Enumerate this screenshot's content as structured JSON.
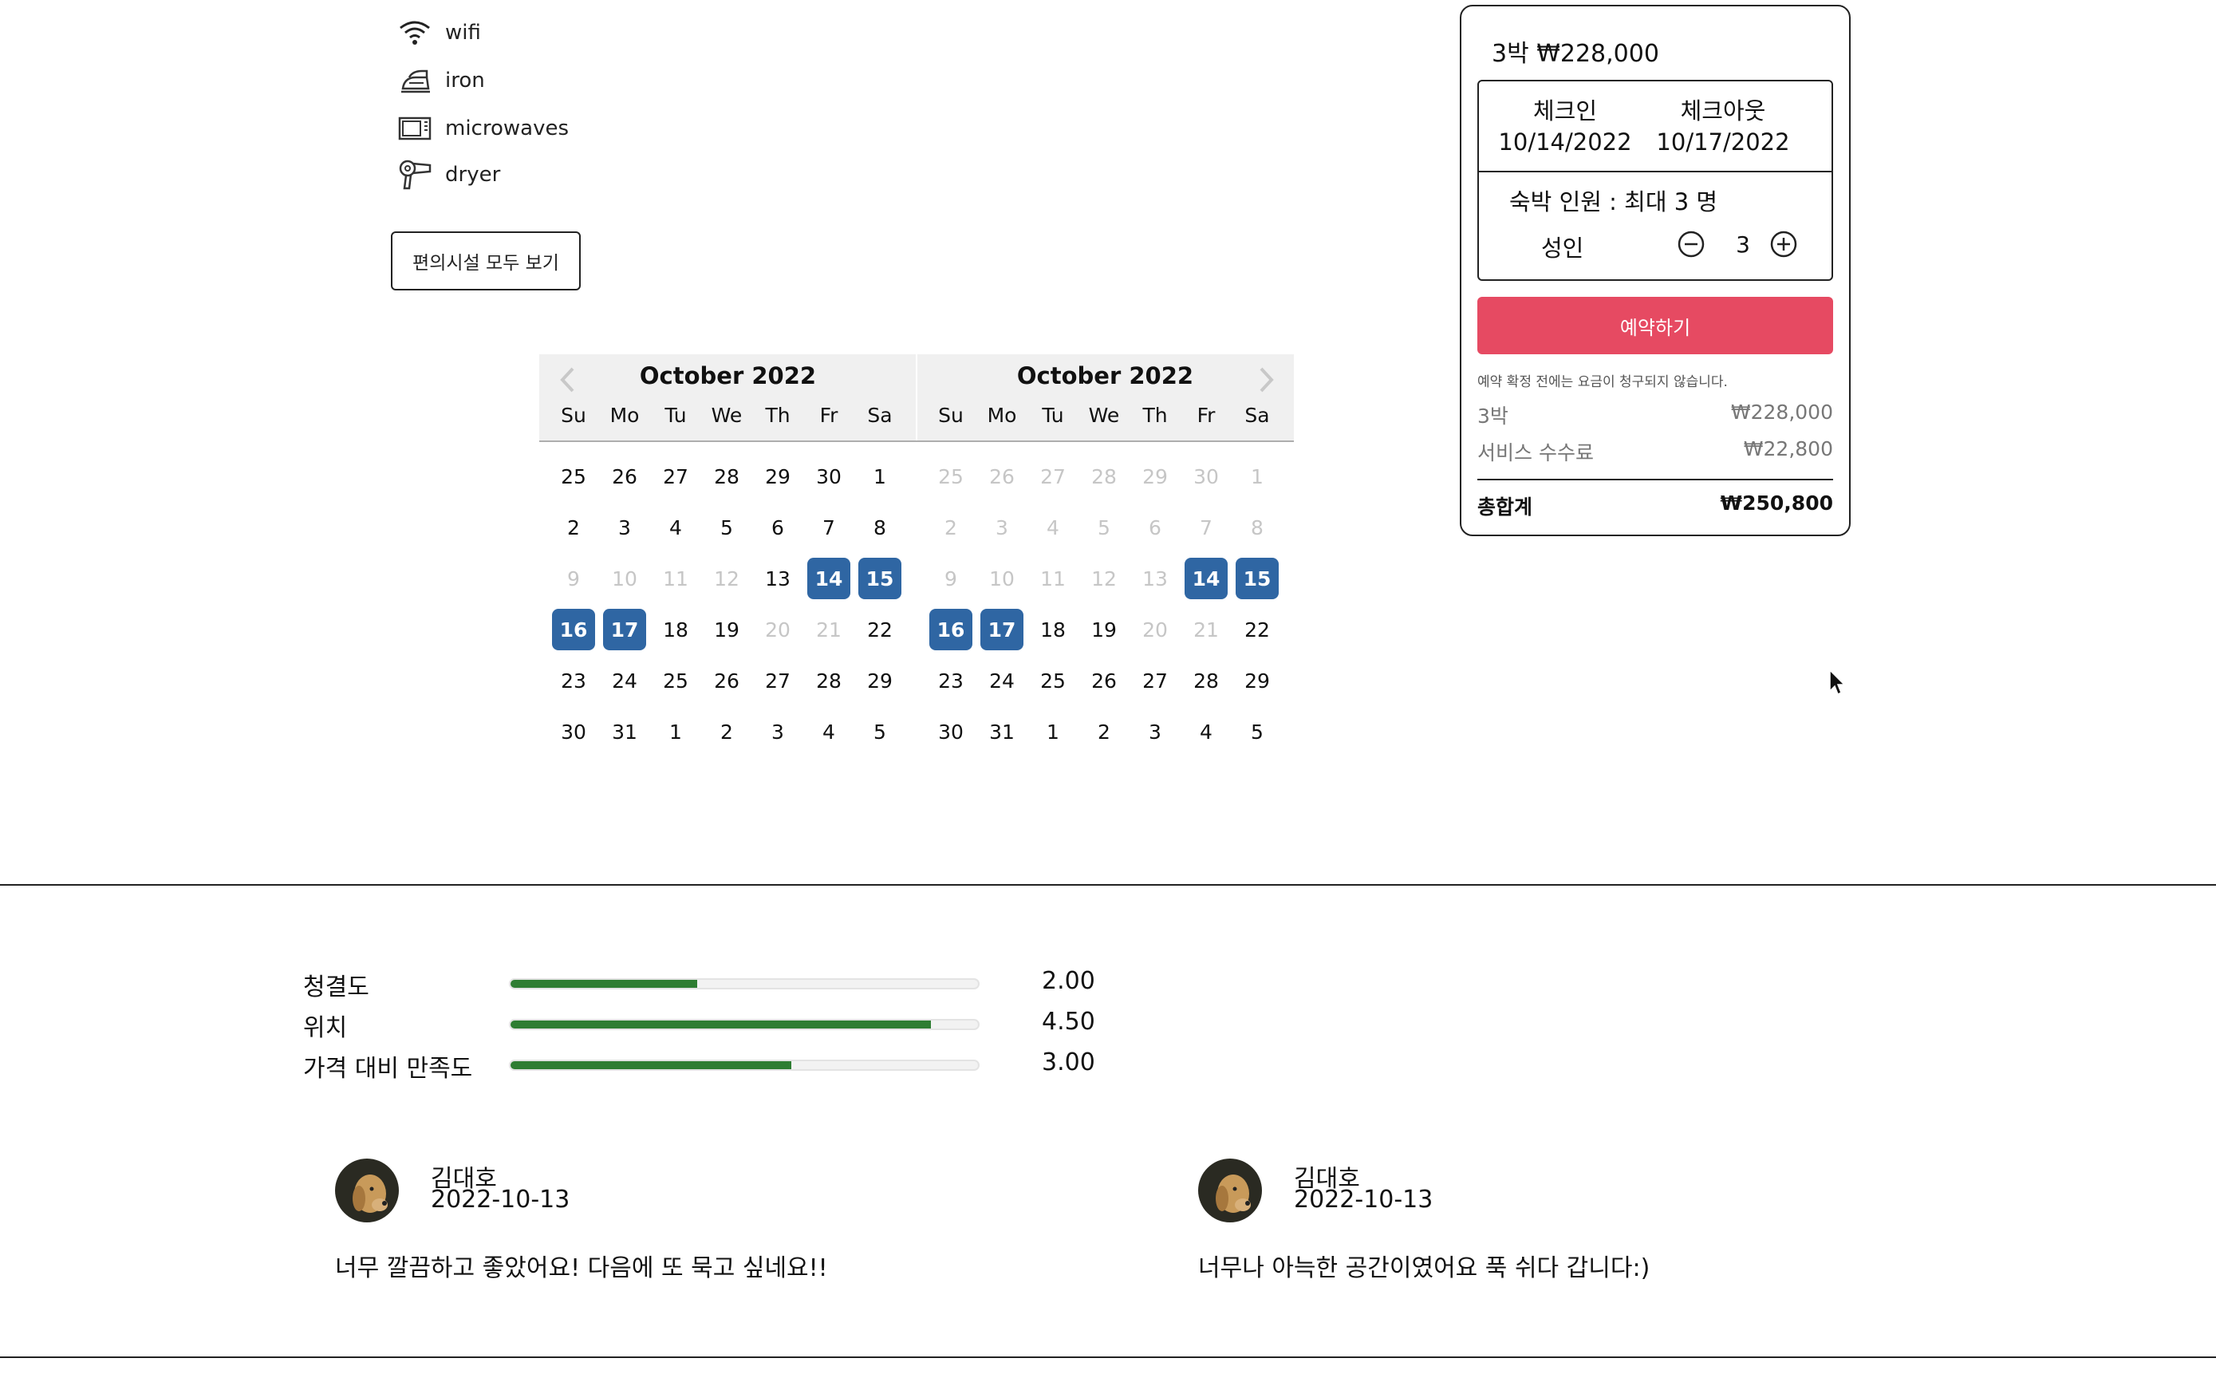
{
  "amenities": {
    "items": [
      {
        "label": "wifi",
        "icon": "wifi-icon"
      },
      {
        "label": "iron",
        "icon": "iron-icon"
      },
      {
        "label": "microwaves",
        "icon": "microwave-icon"
      },
      {
        "label": "dryer",
        "icon": "hair-dryer-icon"
      }
    ],
    "show_all_label": "편의시설 모두 보기"
  },
  "calendar": {
    "months": [
      {
        "title": "October 2022"
      },
      {
        "title": "October 2022"
      }
    ],
    "weekdays": [
      "Su",
      "Mo",
      "Tu",
      "We",
      "Th",
      "Fr",
      "Sa"
    ],
    "selected_color": "#2f66a3",
    "left_month_days": [
      [
        "25",
        "26",
        "27",
        "28",
        "29",
        "30",
        "1"
      ],
      [
        "2",
        "3",
        "4",
        "5",
        "6",
        "7",
        "8"
      ],
      [
        "9",
        "10",
        "11",
        "12",
        "13",
        "14",
        "15"
      ],
      [
        "16",
        "17",
        "18",
        "19",
        "20",
        "21",
        "22"
      ],
      [
        "23",
        "24",
        "25",
        "26",
        "27",
        "28",
        "29"
      ],
      [
        "30",
        "31",
        "1",
        "2",
        "3",
        "4",
        "5"
      ]
    ],
    "right_month_days": [
      [
        "25",
        "26",
        "27",
        "28",
        "29",
        "30",
        "1"
      ],
      [
        "2",
        "3",
        "4",
        "5",
        "6",
        "7",
        "8"
      ],
      [
        "9",
        "10",
        "11",
        "12",
        "13",
        "14",
        "15"
      ],
      [
        "16",
        "17",
        "18",
        "19",
        "20",
        "21",
        "22"
      ],
      [
        "23",
        "24",
        "25",
        "26",
        "27",
        "28",
        "29"
      ],
      [
        "30",
        "31",
        "1",
        "2",
        "3",
        "4",
        "5"
      ]
    ]
  },
  "booking": {
    "price_heading": "3박 ₩228,000",
    "checkin_label": "체크인",
    "checkin_date": "10/14/2022",
    "checkout_label": "체크아웃",
    "checkout_date": "10/17/2022",
    "guests_title": "숙박 인원 : 최대 3 명",
    "adult_label": "성인",
    "adult_count": "3",
    "reserve_label": "예약하기",
    "reserve_color": "#e64a62",
    "notice": "예약 확정 전에는 요금이 청구되지 않습니다.",
    "nights_label": "3박",
    "nights_price": "₩228,000",
    "fee_label": "서비스 수수료",
    "fee_price": "₩22,800",
    "total_label": "총합계",
    "total_price": "₩250,800"
  },
  "ratings": [
    {
      "label": "청결도",
      "value": "2.00",
      "fraction": 0.4
    },
    {
      "label": "위치",
      "value": "4.50",
      "fraction": 0.9
    },
    {
      "label": "가격 대비 만족도",
      "value": "3.00",
      "fraction": 0.6
    }
  ],
  "rating_bar_color": "#2e7d32",
  "reviews": [
    {
      "name": "김대호",
      "date": "2022-10-13",
      "text": "너무 깔끔하고 좋았어요! 다음에 또 묵고 싶네요!!"
    },
    {
      "name": "김대호",
      "date": "2022-10-13",
      "text": "너무나 아늑한 공간이였어요 푹 쉬다 갑니다:)"
    }
  ]
}
